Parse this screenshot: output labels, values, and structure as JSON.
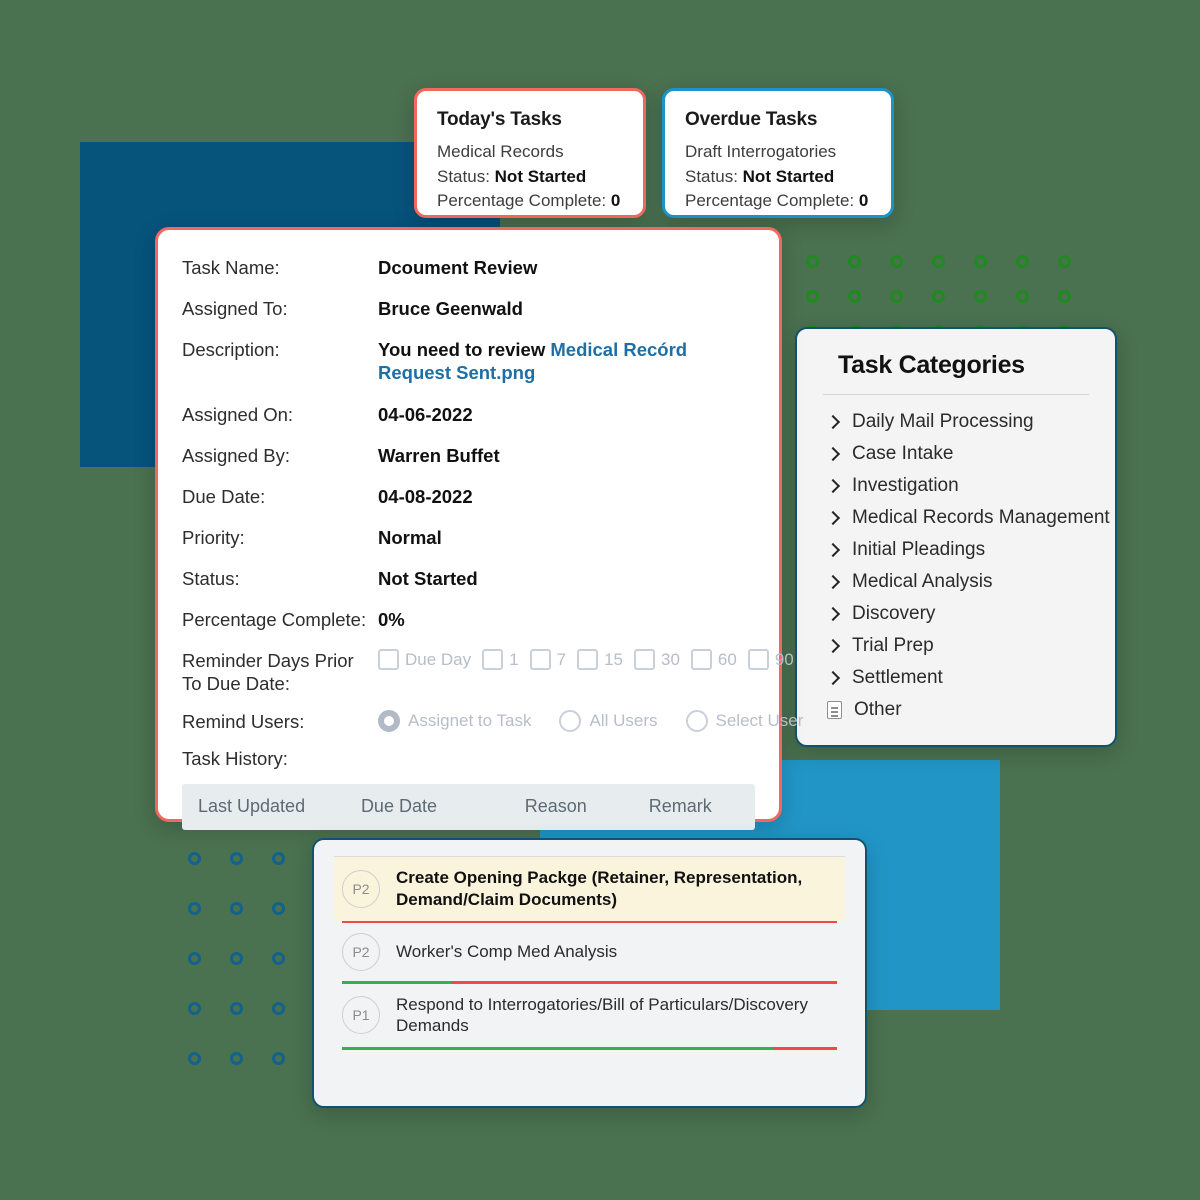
{
  "colors": {
    "background": "#4a7150",
    "dark_blue_rect": "#06537c",
    "light_blue_rect": "#2196c6",
    "today_border": "#f2685f",
    "overdue_border": "#1e93c9",
    "panel_border": "#11536f",
    "link": "#1d6fa5",
    "progress_green": "#36b14a",
    "progress_red": "#ef4b42",
    "highlight_row": "#faf4dc"
  },
  "summary_cards": [
    {
      "title": "Today's Tasks",
      "task": "Medical Records",
      "status_label": "Status:",
      "status_value": "Not Started",
      "percent_label": "Percentage Complete:",
      "percent_value": "0"
    },
    {
      "title": "Overdue Tasks",
      "task": "Draft Interrogatories",
      "status_label": "Status:",
      "status_value": "Not Started",
      "percent_label": "Percentage Complete:",
      "percent_value": "0"
    }
  ],
  "task_detail": {
    "fields": [
      {
        "label": "Task Name:",
        "value": "Dcoument Review"
      },
      {
        "label": "Assigned To:",
        "value": "Bruce Geenwald"
      },
      {
        "label": "Description:",
        "value": "You need to review",
        "link": "Medical Recórd Request Sent.png"
      },
      {
        "label": "Assigned On:",
        "value": "04-06-2022"
      },
      {
        "label": "Assigned By:",
        "value": "Warren Buffet"
      },
      {
        "label": "Due Date:",
        "value": "04-08-2022"
      },
      {
        "label": "Priority:",
        "value": "Normal"
      },
      {
        "label": "Status:",
        "value": "Not Started"
      },
      {
        "label": "Percentage Complete:",
        "value": "0%"
      }
    ],
    "reminder": {
      "label": "Reminder Days Prior To Due Date:",
      "options": [
        "Due Day",
        "1",
        "7",
        "15",
        "30",
        "60",
        "90"
      ],
      "checked": []
    },
    "remind_users": {
      "label": "Remind Users:",
      "options": [
        "Assignet to Task",
        "All Users",
        "Select User"
      ],
      "selected": "Assignet to Task"
    },
    "task_history": {
      "label": "Task History:",
      "columns": [
        "Last Updated",
        "Due Date",
        "Reason",
        "Remark"
      ],
      "rows": []
    }
  },
  "task_categories": {
    "title": "Task Categories",
    "items": [
      {
        "label": "Daily Mail Processing",
        "icon": "chevron-right-icon"
      },
      {
        "label": "Case Intake",
        "icon": "chevron-right-icon"
      },
      {
        "label": "Investigation",
        "icon": "chevron-right-icon"
      },
      {
        "label": "Medical Records Management",
        "icon": "chevron-right-icon"
      },
      {
        "label": "Initial Pleadings",
        "icon": "chevron-right-icon"
      },
      {
        "label": "Medical Analysis",
        "icon": "chevron-right-icon"
      },
      {
        "label": "Discovery",
        "icon": "chevron-right-icon"
      },
      {
        "label": "Trial Prep",
        "icon": "chevron-right-icon"
      },
      {
        "label": "Settlement",
        "icon": "chevron-right-icon"
      },
      {
        "label": "Other",
        "icon": "file-icon"
      }
    ]
  },
  "priority_list": {
    "rows": [
      {
        "badge": "P2",
        "text": "Create Opening Packge (Retainer, Representation, Demand/Claim Documents)",
        "highlighted": true,
        "progress_green_pct": 0,
        "progress_red_pct": 100
      },
      {
        "badge": "P2",
        "text": "Worker's Comp Med Analysis",
        "highlighted": false,
        "progress_green_pct": 22,
        "progress_red_pct": 78
      },
      {
        "badge": "P1",
        "text": "Respond to Interrogatories/Bill of Particulars/Discovery Demands",
        "highlighted": false,
        "progress_green_pct": 87,
        "progress_red_pct": 13
      }
    ]
  }
}
